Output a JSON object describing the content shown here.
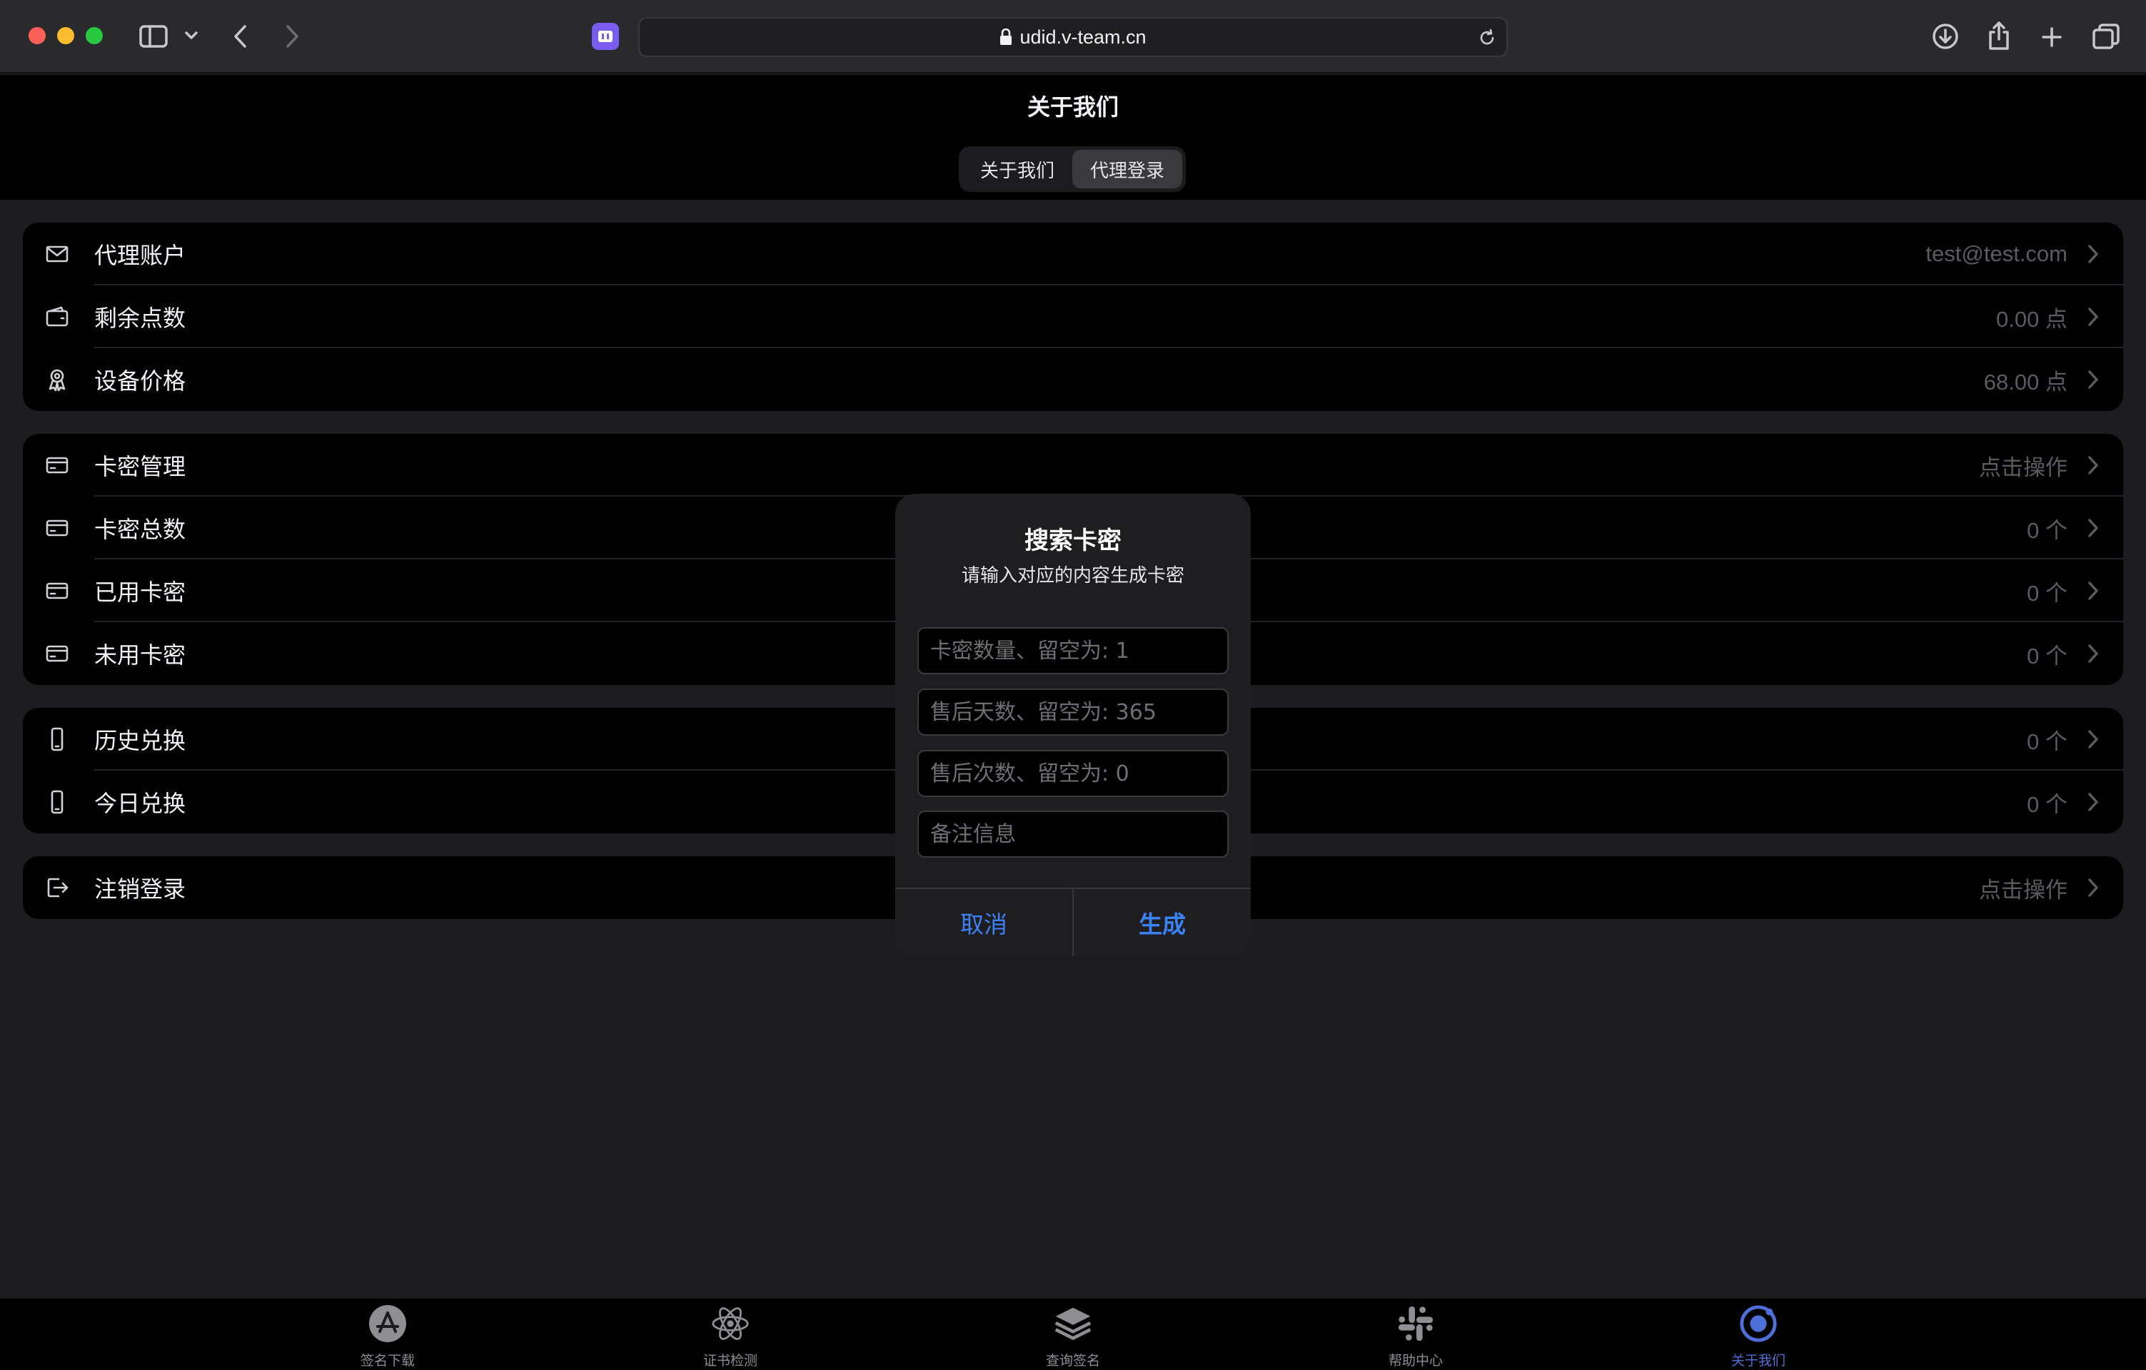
{
  "browser": {
    "url": "udid.v-team.cn"
  },
  "header": {
    "title": "关于我们",
    "tabs": [
      "关于我们",
      "代理登录"
    ]
  },
  "groups": [
    {
      "rows": [
        {
          "icon": "mail-icon",
          "label": "代理账户",
          "value": "test@test.com"
        },
        {
          "icon": "wallet-icon",
          "label": "剩余点数",
          "value": "0.00 点"
        },
        {
          "icon": "award-icon",
          "label": "设备价格",
          "value": "68.00 点"
        }
      ]
    },
    {
      "rows": [
        {
          "icon": "card-icon",
          "label": "卡密管理",
          "value": "点击操作"
        },
        {
          "icon": "card-icon",
          "label": "卡密总数",
          "value": "0 个"
        },
        {
          "icon": "card-icon",
          "label": "已用卡密",
          "value": "0 个"
        },
        {
          "icon": "card-icon",
          "label": "未用卡密",
          "value": "0 个"
        }
      ]
    },
    {
      "rows": [
        {
          "icon": "phone-icon",
          "label": "历史兑换",
          "value": "0 个"
        },
        {
          "icon": "phone-icon",
          "label": "今日兑换",
          "value": "0 个"
        }
      ]
    },
    {
      "rows": [
        {
          "icon": "logout-icon",
          "label": "注销登录",
          "value": "点击操作"
        }
      ]
    }
  ],
  "dialog": {
    "title": "搜索卡密",
    "message": "请输入对应的内容生成卡密",
    "inputs": [
      {
        "placeholder": "卡密数量、留空为: 1"
      },
      {
        "placeholder": "售后天数、留空为: 365"
      },
      {
        "placeholder": "售后次数、留空为: 0"
      },
      {
        "placeholder": "备注信息"
      }
    ],
    "cancel": "取消",
    "confirm": "生成"
  },
  "tabbar": {
    "items": [
      {
        "icon": "app-store-icon",
        "label": "签名下载"
      },
      {
        "icon": "atom-icon",
        "label": "证书检测"
      },
      {
        "icon": "layers-icon",
        "label": "查询签名"
      },
      {
        "icon": "slack-icon",
        "label": "帮助中心"
      },
      {
        "icon": "ionic-icon",
        "label": "关于我们"
      }
    ],
    "active_index": 4
  },
  "colors": {
    "accent": "#3b82f6",
    "background": "#1c1c1e",
    "card": "#000000"
  }
}
